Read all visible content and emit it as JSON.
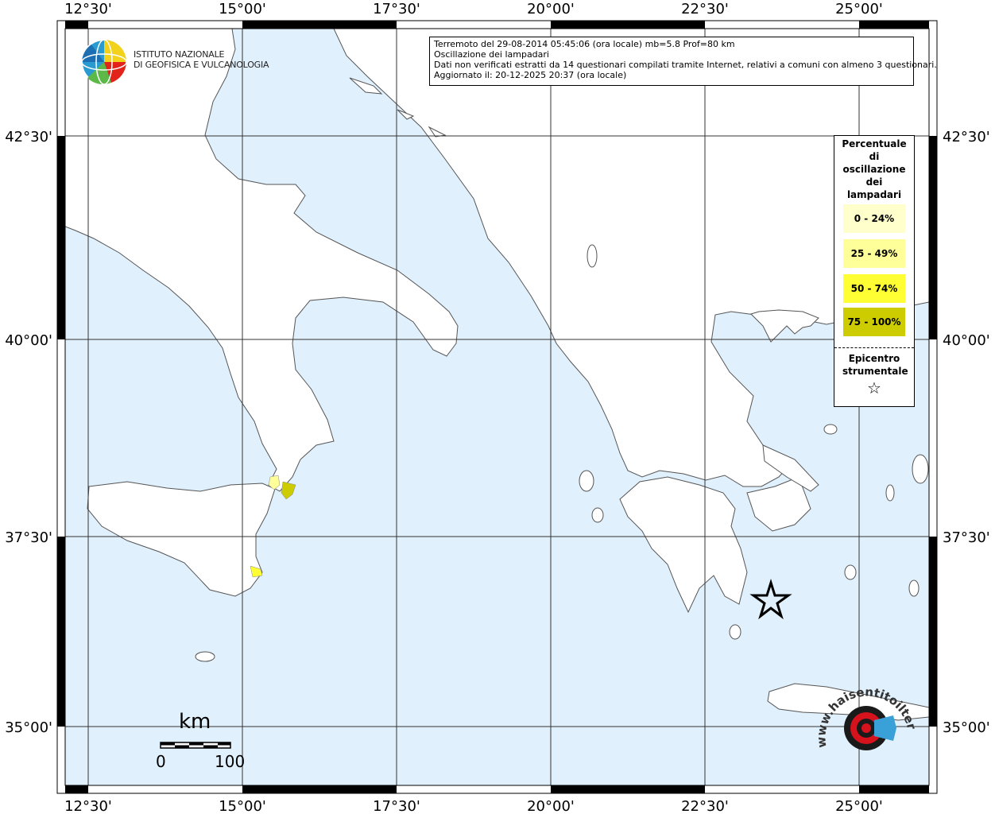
{
  "info": {
    "line1": "Terremoto del 29-08-2014 05:45:06 (ora locale) mb=5.8 Prof=80 km",
    "line2": "Oscillazione dei lampadari",
    "line3": "Dati non verificati estratti da 14 questionari compilati tramite Internet, relativi a comuni con almeno 3 questionari.",
    "line4": "Aggiornato il: 20-12-2025 20:37 (ora locale)"
  },
  "logo": {
    "line1": "ISTITUTO NAZIONALE",
    "line2": "DI GEOFISICA E VULCANOLOGIA"
  },
  "watermark": "www.haisentitoilterremoto.it",
  "axes": {
    "lon_labels": [
      "12°30'",
      "15°00'",
      "17°30'",
      "20°00'",
      "22°30'",
      "25°00'"
    ],
    "lat_labels": [
      "42°30'",
      "40°00'",
      "37°30'",
      "35°00'"
    ]
  },
  "legend": {
    "title": "Percentuale di oscillazione dei lampadari",
    "classes": [
      {
        "label": "0 - 24%",
        "color": "#ffffcc"
      },
      {
        "label": "25 - 49%",
        "color": "#ffff99"
      },
      {
        "label": "50 - 74%",
        "color": "#ffff33"
      },
      {
        "label": "75 - 100%",
        "color": "#cccc00"
      }
    ],
    "epicenter_label": "Epicentro strumentale",
    "epicenter_symbol": "☆"
  },
  "scale": {
    "unit": "km",
    "min": "0",
    "max": "100"
  },
  "colors": {
    "sea": "#e0f0fc",
    "land": "#ffffff",
    "frame": "#000000"
  }
}
